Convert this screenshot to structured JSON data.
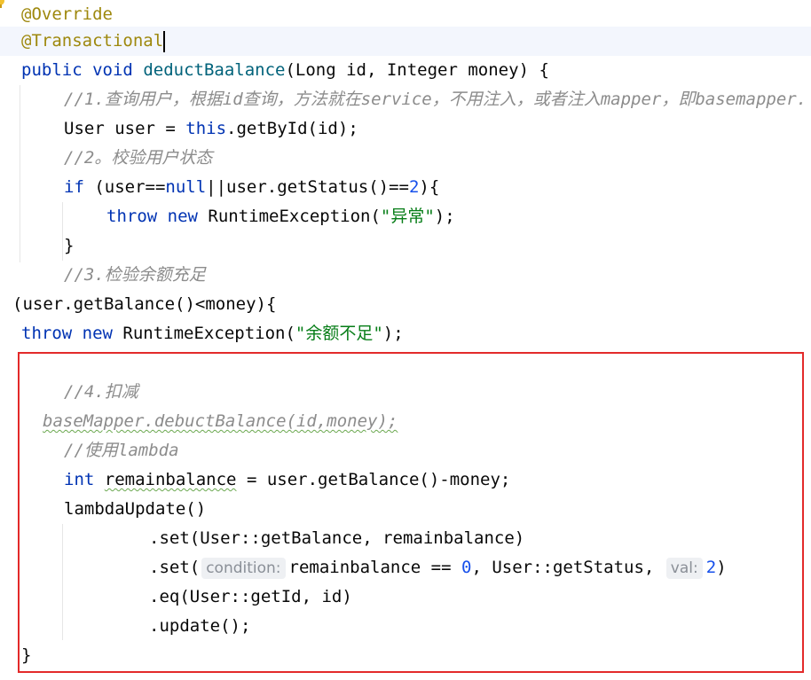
{
  "code": {
    "l1": "@Override",
    "l2": "@Transactional",
    "l3_kw1": "public",
    "l3_kw2": "void",
    "l3_fn": "deductBaalance",
    "l3_rest": "(Long id, Integer money) {",
    "l4": "//1.查询用户，根据id查询，方法就在service，不用注入，或者注入mapper，即basemapper.",
    "l5_a": "User user = ",
    "l5_this": "this",
    "l5_b": ".getById(id);",
    "l6": "//2。校验用户状态",
    "l7_if": "if",
    "l7_a": " (user==",
    "l7_null": "null",
    "l7_b": "||user.getStatus()==",
    "l7_num": "2",
    "l7_c": "){",
    "l8_throw": "throw",
    "l8_new": "new",
    "l8_a": " RuntimeException(",
    "l8_str": "\"异常\"",
    "l8_b": ");",
    "l9": "}",
    "l10": "//3.检验余额充足",
    "l11": "(user.getBalance()<money){",
    "l12_throw": "throw",
    "l12_new": "new",
    "l12_a": " RuntimeException(",
    "l12_str": "\"余额不足\"",
    "l12_b": ");",
    "l13": "//4.扣减",
    "l14": "baseMapper.debuctBalance(id,money);",
    "l15": "//使用lambda",
    "l16_int": "int",
    "l16_var": "remainbalance",
    "l16_rest": " = user.getBalance()-money;",
    "l17": "lambdaUpdate()",
    "l18": ".set(User::getBalance, remainbalance)",
    "l19_a": ".set(",
    "l19_hint1": "condition:",
    "l19_b": "remainbalance == ",
    "l19_num1": "0",
    "l19_c": ", User::getStatus, ",
    "l19_hint2": "val:",
    "l19_num2": "2",
    "l19_d": ")",
    "l20": ".eq(User::getId, id)",
    "l21": ".update();",
    "l22": "}"
  },
  "colors": {
    "annotation": "#9e880d",
    "keyword": "#0033b3",
    "method": "#00627a",
    "number": "#1750eb",
    "string": "#067d17",
    "comment": "#8c8c8c",
    "highlight_box": "#e32a2a"
  },
  "icons": {
    "gutter": "lightbulb-icon"
  }
}
